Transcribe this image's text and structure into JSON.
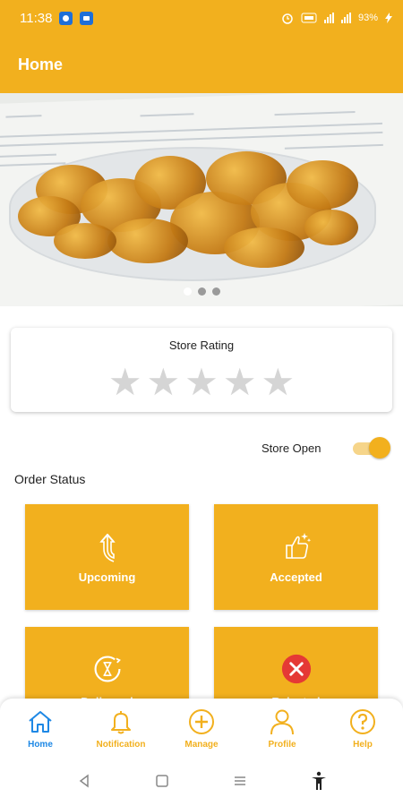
{
  "status_bar": {
    "time": "11:38",
    "right_text": "93%",
    "icons": [
      "app-notification-icon",
      "app-notification-icon",
      "alarm-icon",
      "volte-icon",
      "network-icon",
      "signal-icon",
      "battery-charging-icon"
    ]
  },
  "app_bar": {
    "title": "Home"
  },
  "banner": {
    "slides_count": 3,
    "active_slide": 1
  },
  "rating": {
    "title": "Store Rating",
    "stars_filled": 0,
    "stars_total": 5
  },
  "store_toggle": {
    "label": "Store Open",
    "on": true
  },
  "order_status": {
    "title": "Order Status",
    "tiles": [
      {
        "label": "Upcoming",
        "icon": "upcoming-arrow-icon"
      },
      {
        "label": "Accepted",
        "icon": "thumbs-up-icon"
      },
      {
        "label": "Delivered",
        "icon": "delivered-hourglass-icon"
      },
      {
        "label": "Rejected",
        "icon": "rejected-x-icon"
      }
    ]
  },
  "bottom_nav": {
    "items": [
      {
        "label": "Home",
        "icon": "home-icon",
        "active": true
      },
      {
        "label": "Notification",
        "icon": "bell-icon",
        "active": false
      },
      {
        "label": "Manage",
        "icon": "plus-circle-icon",
        "active": false
      },
      {
        "label": "Profile",
        "icon": "user-icon",
        "active": false
      },
      {
        "label": "Help",
        "icon": "help-icon",
        "active": false
      }
    ]
  },
  "colors": {
    "primary": "#F2B01E",
    "active_nav": "#1E88E5",
    "reject": "#E53935",
    "star_empty": "#D5D5D5"
  }
}
